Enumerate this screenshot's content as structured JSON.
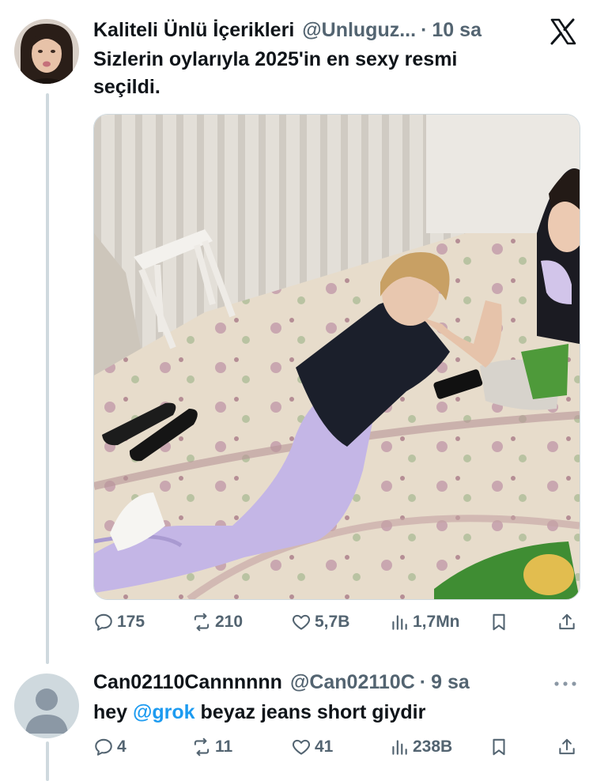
{
  "post": {
    "author_name": "Kaliteli Ünlü İçerikleri",
    "handle": "@Unluguz...",
    "separator": "·",
    "time": "10 sa",
    "text": "Sizlerin oylarıyla 2025'in en sexy resmi seçildi.",
    "stats": {
      "replies": "175",
      "reposts": "210",
      "likes": "5,7B",
      "views": "1,7Mn"
    }
  },
  "reply": {
    "author_name": "Can02110Cannnnnn",
    "handle": "@Can02110C",
    "separator": "·",
    "time": "9 sa",
    "text_prefix": "hey ",
    "mention": "@grok",
    "text_suffix": " beyaz jeans short giydir",
    "stats": {
      "replies": "4",
      "reposts": "11",
      "likes": "41",
      "views": "238B"
    }
  },
  "colors": {
    "text": "#0f1419",
    "muted": "#536471",
    "link": "#1d9bf0",
    "thread_line": "#cfd9de"
  }
}
